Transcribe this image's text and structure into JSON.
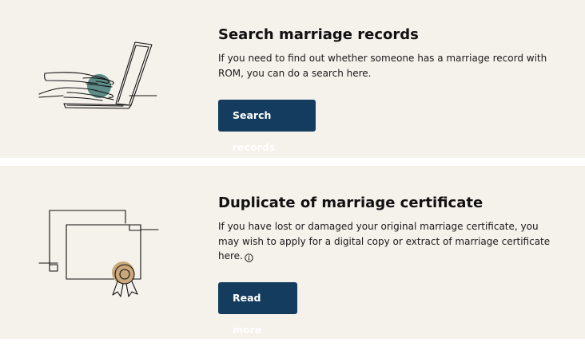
{
  "cards": [
    {
      "title": "Search marriage records",
      "description": "If you need to find out whether someone has a marriage record with ROM, you can do a search here.",
      "button_label": "Search records",
      "illustration": "laptop-typing-illustration"
    },
    {
      "title": "Duplicate of marriage certificate",
      "description": "If you have lost or damaged your original marriage certificate, you may wish to apply for a digital copy or extract of marriage certificate here.",
      "button_label": "Read more",
      "illustration": "certificate-illustration",
      "trailing_icon": "info-icon"
    }
  ],
  "colors": {
    "card_background": "#f5f1eb",
    "button_background": "#143c5f",
    "button_text": "#ffffff",
    "laptop_accent": "#5e8c88",
    "seal_accent": "#c9a77a"
  }
}
